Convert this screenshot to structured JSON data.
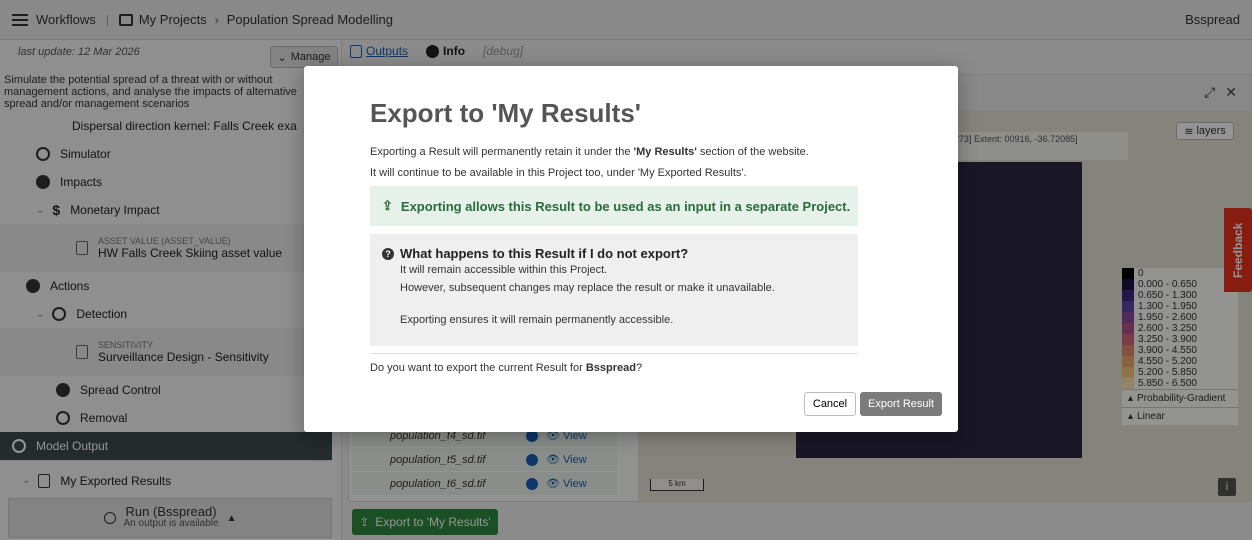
{
  "topbar": {
    "workflows": "Workflows",
    "projects": "My Projects",
    "project_name": "Population Spread Modelling",
    "user": "Bsspread"
  },
  "sidebar": {
    "last_update": "last update: 12 Mar 2026",
    "manage": "Manage",
    "description": "Simulate the potential spread of a threat with or without management actions, and analyse the impacts of alternative spread and/or management scenarios",
    "items": [
      {
        "label": "Dispersal direction kernel: Falls Creek exa"
      },
      {
        "label": "Simulator"
      },
      {
        "label": "Impacts"
      },
      {
        "label": "Monetary Impact"
      },
      {
        "small": "ASSET VALUE (ASSET_VALUE)",
        "big": "HW Falls Creek Skiing asset value"
      },
      {
        "label": "Actions"
      },
      {
        "label": "Detection"
      },
      {
        "small": "SENSITIVITY",
        "big": "Surveillance Design - Sensitivity"
      },
      {
        "label": "Spread Control"
      },
      {
        "label": "Removal"
      },
      {
        "label": "Model Output"
      },
      {
        "label": "My Exported Results"
      }
    ],
    "run": {
      "main": "Run (Bsspread)",
      "sub": "An output is available"
    }
  },
  "tabs": {
    "outputs": "Outputs",
    "info": "Info",
    "debug": "[debug]"
  },
  "files": [
    {
      "name": "population_t4_sd.tif",
      "view": "View"
    },
    {
      "name": "population_t5_sd.tif",
      "view": "View"
    },
    {
      "name": "population_t6_sd.tif",
      "view": "View"
    }
  ],
  "export_button": "Export to 'My Results'",
  "map": {
    "extent_text": "273] Extent: 00916, -36.72085]",
    "layers": "layers",
    "scale": "5 km",
    "legend": [
      {
        "label": "0",
        "color": "#000000"
      },
      {
        "label": "0.000 - 0.650",
        "color": "#1c1440"
      },
      {
        "label": "0.650 - 1.300",
        "color": "#3b2a7a"
      },
      {
        "label": "1.300 - 1.950",
        "color": "#5a45a8"
      },
      {
        "label": "1.950 - 2.600",
        "color": "#8a4a9a"
      },
      {
        "label": "2.600 - 3.250",
        "color": "#b0548a"
      },
      {
        "label": "3.250 - 3.900",
        "color": "#d26a7a"
      },
      {
        "label": "3.900 - 4.550",
        "color": "#e48a6e"
      },
      {
        "label": "4.550 - 5.200",
        "color": "#eeaa6a"
      },
      {
        "label": "5.200 - 5.850",
        "color": "#f3c97e"
      },
      {
        "label": "5.850 - 6.500",
        "color": "#f8e6b0"
      }
    ],
    "legend_controls": [
      "Probability-Gradient",
      "Linear"
    ],
    "feedback": "Feedback"
  },
  "modal": {
    "title": "Export to 'My Results'",
    "p1_pre": "Exporting a Result will permanently retain it under the ",
    "p1_bold": "'My Results'",
    "p1_post": " section of the website.",
    "p2": "It will continue to be available in this Project too, under 'My Exported Results'.",
    "green": "Exporting allows this Result to be used as an input in a separate Project.",
    "question": "What happens to this Result if I do not export?",
    "line1": "It will remain accessible within this Project.",
    "line2": "However, subsequent changes may replace the result or make it unavailable.",
    "line3": "Exporting ensures it will remain permanently accessible.",
    "ask_pre": "Do you want to export the current Result for ",
    "ask_bold": "Bsspread",
    "ask_post": "?",
    "cancel": "Cancel",
    "export": "Export Result"
  }
}
